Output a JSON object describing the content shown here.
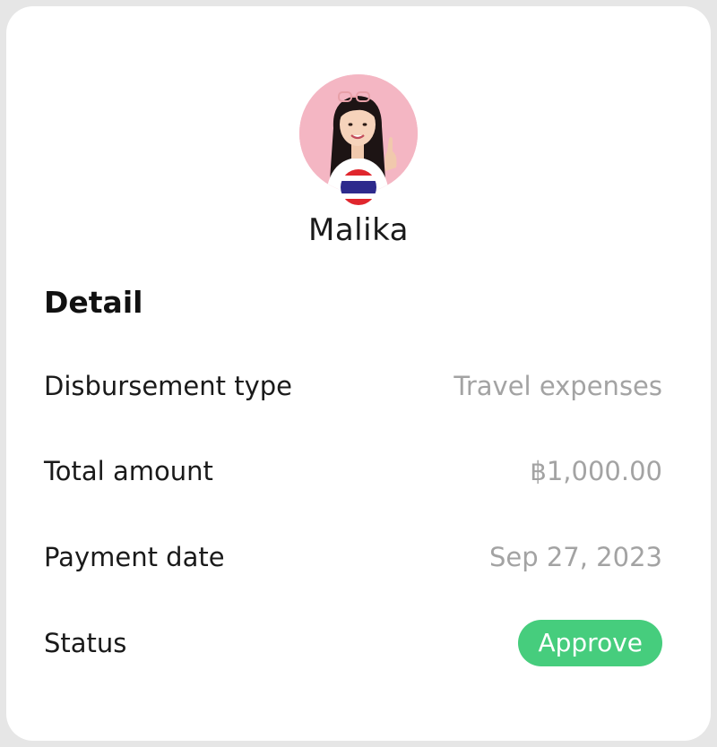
{
  "profile": {
    "name": "Malika",
    "flag_icon": "thailand-flag-icon",
    "avatar_background": "#f4b6c3"
  },
  "detail": {
    "title": "Detail",
    "rows": [
      {
        "label": "Disbursement type",
        "value": "Travel expenses"
      },
      {
        "label": "Total amount",
        "value": "฿1,000.00"
      },
      {
        "label": "Payment date",
        "value": "Sep 27, 2023"
      },
      {
        "label": "Status",
        "value": "Approve"
      }
    ]
  },
  "colors": {
    "status_approve": "#46cd7d",
    "value_text": "#a3a3a3",
    "card_background": "#ffffff",
    "frame_background": "#e6e6e6"
  }
}
